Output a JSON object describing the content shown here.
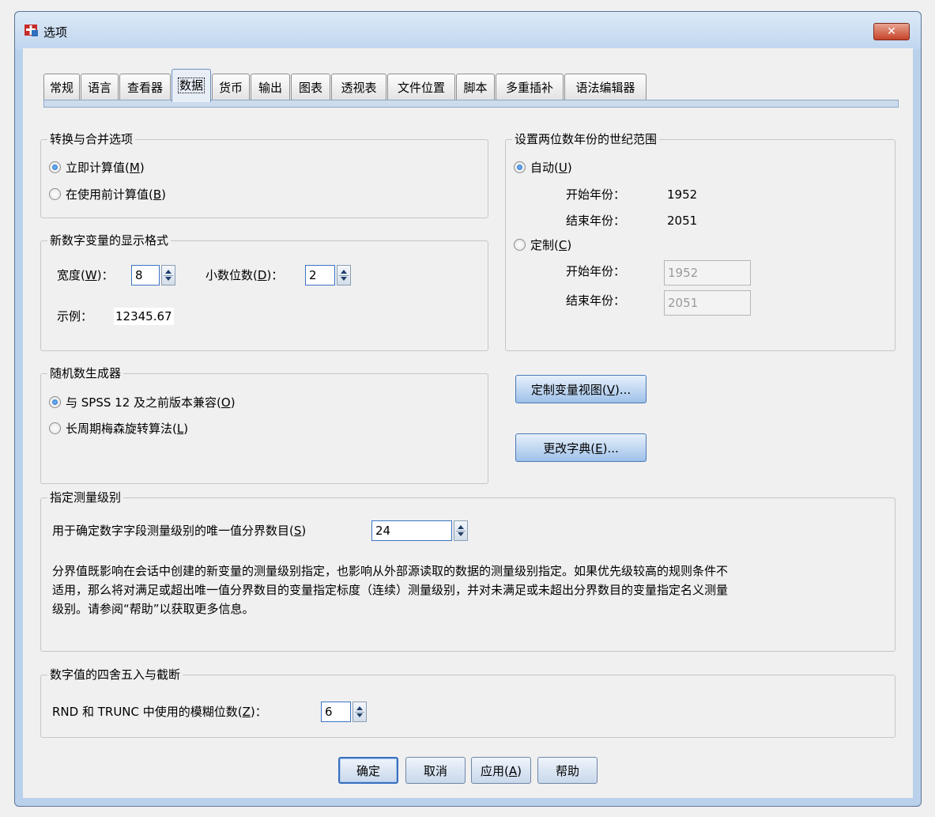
{
  "dialog": {
    "title": "选项",
    "close_label": "✕"
  },
  "tabs": [
    {
      "label": "常规"
    },
    {
      "label": "语言"
    },
    {
      "label": "查看器"
    },
    {
      "label": "数据",
      "active": true
    },
    {
      "label": "货币"
    },
    {
      "label": "输出"
    },
    {
      "label": "图表"
    },
    {
      "label": "透视表"
    },
    {
      "label": "文件位置"
    },
    {
      "label": "脚本"
    },
    {
      "label": "多重插补"
    },
    {
      "label": "语法编辑器"
    }
  ],
  "transform_group": {
    "legend": "转换与合并选项",
    "opt_immediate": {
      "label": "立即计算值",
      "mnemonic": "M",
      "selected": true
    },
    "opt_before_use": {
      "label": "在使用前计算值",
      "mnemonic": "B",
      "selected": false
    }
  },
  "display_format_group": {
    "legend": "新数字变量的显示格式",
    "width": {
      "label": "宽度",
      "mnemonic": "W",
      "value": "8"
    },
    "decimals": {
      "label": "小数位数",
      "mnemonic": "D",
      "value": "2"
    },
    "example_label": "示例：",
    "example_value": "12345.67"
  },
  "random_group": {
    "legend": "随机数生成器",
    "opt_spss12": {
      "label": "与 SPSS 12 及之前版本兼容",
      "mnemonic": "O",
      "selected": true
    },
    "opt_mersenne": {
      "label": "长周期梅森旋转算法",
      "mnemonic": "L",
      "selected": false
    }
  },
  "century_group": {
    "legend": "设置两位数年份的世纪范围",
    "opt_auto": {
      "label": "自动",
      "mnemonic": "U",
      "selected": true
    },
    "auto_start_label": "开始年份：",
    "auto_start_value": "1952",
    "auto_end_label": "结束年份：",
    "auto_end_value": "2051",
    "opt_custom": {
      "label": "定制",
      "mnemonic": "C",
      "selected": false
    },
    "custom_start_label": "开始年份：",
    "custom_start_value": "1952",
    "custom_end_label": "结束年份：",
    "custom_end_value": "2051"
  },
  "side_buttons": {
    "customize_view": {
      "label": "定制变量视图",
      "mnemonic": "V",
      "suffix": "..."
    },
    "change_dictionary": {
      "label": "更改字典",
      "mnemonic": "E",
      "suffix": "..."
    }
  },
  "measurement_group": {
    "legend": "指定测量级别",
    "cutoff_label": "用于确定数字字段测量级别的唯一值分界数目",
    "cutoff_mnemonic": "S",
    "cutoff_value": "24",
    "description_lines": [
      "分界值既影响在会话中创建的新变量的测量级别指定，也影响从外部源读取的数据的测量级别指定。如果优先级较高的规则条件不",
      "适用，那么将对满足或超出唯一值分界数目的变量指定标度（连续）测量级别，并对未满足或未超出分界数目的变量指定名义测量",
      "级别。请参阅“帮助”以获取更多信息。"
    ]
  },
  "rounding_group": {
    "legend": "数字值的四舍五入与截断",
    "fuzz_label": "RND 和 TRUNC 中使用的模糊位数",
    "fuzz_mnemonic": "Z",
    "fuzz_suffix": "：",
    "fuzz_value": "6"
  },
  "footer": {
    "ok": "确定",
    "cancel": "取消",
    "apply": {
      "label": "应用",
      "mnemonic": "A"
    },
    "help": "帮助"
  }
}
